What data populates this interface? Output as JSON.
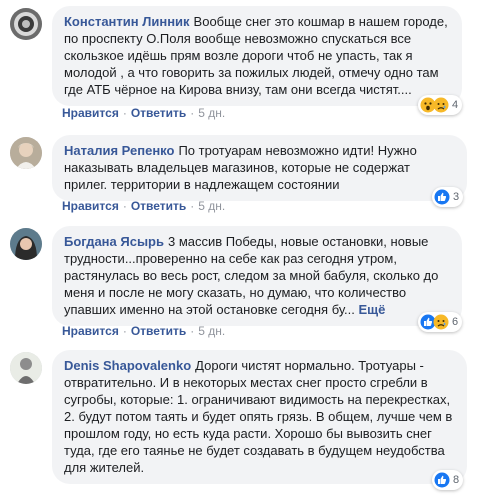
{
  "colors": {
    "link": "#385898",
    "bubble": "#f2f3f5",
    "meta": "#90949c"
  },
  "comments": [
    {
      "author": "Константин Линник",
      "text": "Вообще снег это кошмар в нашем городе, по проспекту О.Поля вообще невозможно спускаться все скользкое идёшь прям возле дороги чтоб не упасть, так я молодой , а что говорить за пожилых людей, отмечу одно там где АТБ чёрное на Кирова внизу, там они всегда чистят....",
      "more": "",
      "like": "Нравится",
      "reply": "Ответить",
      "age": "5 дн.",
      "reaction_icons": [
        "wow-icon",
        "sad-icon"
      ],
      "reaction_count": "4"
    },
    {
      "author": "Наталия Репенко",
      "text": "По тротуарам невозможно идти! Нужно наказывать владельцев магазинов, которые не содержат прилег. территории в надлежащем состоянии",
      "more": "",
      "like": "Нравится",
      "reply": "Ответить",
      "age": "5 дн.",
      "reaction_icons": [
        "like-icon"
      ],
      "reaction_count": "3"
    },
    {
      "author": "Богдана Ясырь",
      "text": "3 массив Победы, новые остановки, новые трудности...проверенно на себе как раз сегодня утром, растянулась во весь рост, следом за мной бабуля, сколько до меня и после не могу сказать, но думаю, что количество упавших именно на этой остановке сегодня бу...",
      "more": "Ещё",
      "like": "Нравится",
      "reply": "Ответить",
      "age": "5 дн.",
      "reaction_icons": [
        "like-icon",
        "sad-icon"
      ],
      "reaction_count": "6"
    },
    {
      "author": "Denis Shapovalenko",
      "text": "Дороги чистят нормально. Тротуары - отвратительно. И в некоторых местах снег просто сгребли в сугробы, которые: 1. ограничивают видимость на перекрестках, 2. будут потом таять и будет опять грязь. В общем, лучше чем в прошлом году, но есть куда расти. Хорошо бы вывозить снег туда, где его таянье не будет создавать в будущем неудобства для жителей.",
      "more": "",
      "like": "Нравится",
      "reply": "Ответить",
      "age": "5 дн.",
      "reaction_icons": [
        "like-icon"
      ],
      "reaction_count": "8"
    }
  ]
}
